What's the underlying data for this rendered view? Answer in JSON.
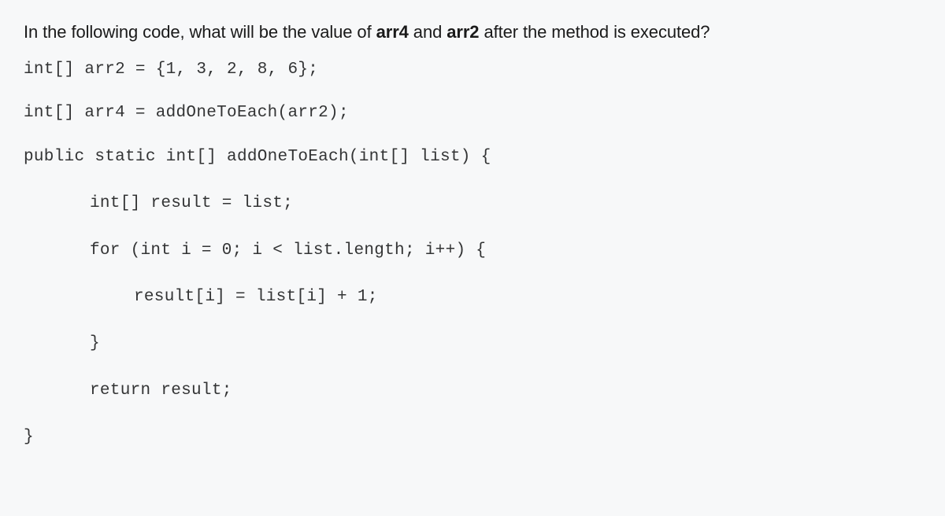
{
  "question": {
    "prefix": "In the following code, what will be the value of ",
    "bold1": "arr4",
    "mid": " and ",
    "bold2": "arr2",
    "suffix": " after the method is executed?"
  },
  "code": {
    "line1": "int[] arr2 = {1, 3, 2, 8, 6};",
    "line2": "int[] arr4 = addOneToEach(arr2);",
    "line3": "public static int[] addOneToEach(int[] list) {",
    "line4": "int[] result = list;",
    "line5": "for (int i = 0; i < list.length; i++) {",
    "line6": "result[i] = list[i] + 1;",
    "line7": "}",
    "line8": "return result;",
    "line9": "}"
  }
}
